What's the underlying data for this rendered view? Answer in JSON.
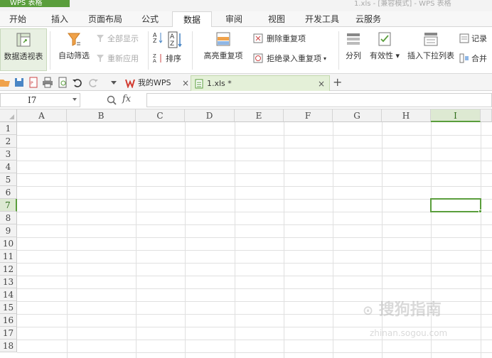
{
  "titlebar": {
    "app_name": "WPS 表格",
    "title_rest": "1.xls - [兼容模式] - WPS 表格"
  },
  "menu": {
    "tabs": [
      {
        "label": "开始"
      },
      {
        "label": "插入"
      },
      {
        "label": "页面布局"
      },
      {
        "label": "公式"
      },
      {
        "label": "数据",
        "active": true
      },
      {
        "label": "审阅"
      },
      {
        "label": "视图"
      },
      {
        "label": "开发工具"
      },
      {
        "label": "云服务"
      }
    ]
  },
  "ribbon": {
    "pivot": "数据透视表",
    "autofilter": "自动筛选",
    "show_all": "全部显示",
    "reapply": "重新应用",
    "sort": "排序",
    "highlight_dup": "高亮重复项",
    "delete_dup": "删除重复项",
    "reject_dup": "拒绝录入重复项",
    "split": "分列",
    "validity": "有效性",
    "insert_dropdown": "插入下拉列表",
    "record": "记录",
    "merge": "合并"
  },
  "doc_tabs": {
    "home": "我的WPS",
    "file": "1.xls *",
    "close": "×",
    "add": "+"
  },
  "formula_bar": {
    "cell_ref": "I7",
    "fx": "fx",
    "value": ""
  },
  "sheet": {
    "columns": [
      "A",
      "B",
      "C",
      "D",
      "E",
      "F",
      "G",
      "H",
      "I"
    ],
    "rows": [
      "1",
      "2",
      "3",
      "4",
      "5",
      "6",
      "7",
      "8",
      "9",
      "10",
      "11",
      "12",
      "13",
      "14",
      "15",
      "16",
      "17",
      "18"
    ],
    "active_col": "I",
    "active_row": "7"
  },
  "watermark": {
    "text": "搜狗指南",
    "url": "zhinan.sogou.com"
  },
  "colors": {
    "accent": "#5a9e3c",
    "grid": "#e0e0e0"
  }
}
